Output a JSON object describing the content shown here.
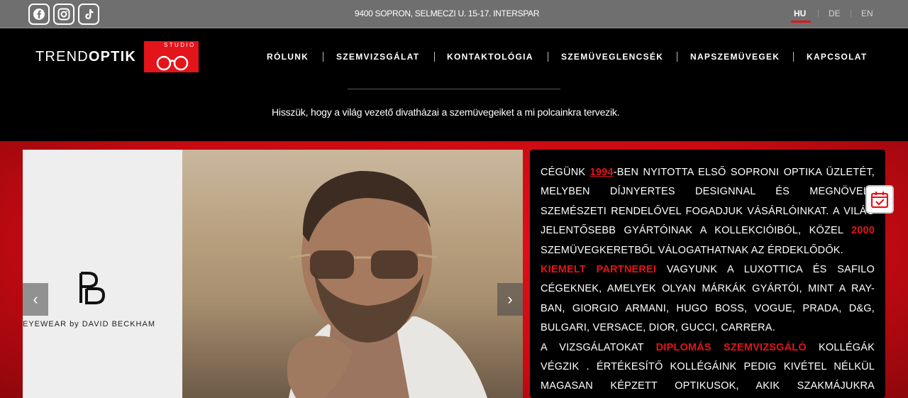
{
  "topbar": {
    "social": [
      {
        "icon": "facebook-icon"
      },
      {
        "icon": "instagram-icon"
      },
      {
        "icon": "tiktok-icon"
      }
    ],
    "address": "9400 SOPRON, SELMECZI U. 15-17. INTERSPAR",
    "languages": [
      {
        "code": "HU",
        "active": true
      },
      {
        "code": "DE",
        "active": false
      },
      {
        "code": "EN",
        "active": false
      }
    ]
  },
  "logo": {
    "prefix": "TREND",
    "bold": "OPTIK",
    "studio": "STUDIO"
  },
  "nav": {
    "items": [
      {
        "label": "RÓLUNK"
      },
      {
        "label": "SZEMVIZSGÁLAT"
      },
      {
        "label": "KONTAKTOLÓGIA"
      },
      {
        "label": "SZEMÜVEGLENCSÉK"
      },
      {
        "label": "NAPSZEMÜVEGEK"
      },
      {
        "label": "KAPCSOLAT"
      }
    ]
  },
  "tagline": "Hisszük, hogy a világ vezető divatházai a szemüvegeiket a mi polcainkra tervezik.",
  "slider": {
    "brand_caption": "EYEWEAR by DAVID BECKHAM",
    "prev_label": "‹",
    "next_label": "›"
  },
  "info": {
    "p1_a": "Cégünk ",
    "p1_year": "1994",
    "p1_b": "-ben nyitotta első soproni optika üzletét, melyben díjnyertes designnal és megnövelt szemészeti rendelővel fogadjuk vásárlóinkat. A világ jelentősebb gyártóinak a kollekcióiból, közel ",
    "p1_count": "2000",
    "p1_c": " szemüvegkeretből válogathatnak az érdeklődők.",
    "p2_hl": "Kiemelt partnerei",
    "p2_rest": " vagyunk a Luxottica és Safilo cégeknek, amelyek olyan márkák gyártói, mint a Ray-Ban, Giorgio Armani, Hugo Boss, Vogue, Prada, D&G, Bulgari, Versace, Dior, Gucci, Carrera.",
    "p3_a": "A vizsgálatokat ",
    "p3_hl": "diplomás szemvizsgáló",
    "p3_b": " kollégák végzik . Értékesítő kollégáink pedig kivétel nélkül magasan képzett optikusok, akik szakmájukra hivatásként"
  },
  "colors": {
    "accent": "#e3141a",
    "topbar": "#6f6f6f",
    "header": "#000000"
  }
}
